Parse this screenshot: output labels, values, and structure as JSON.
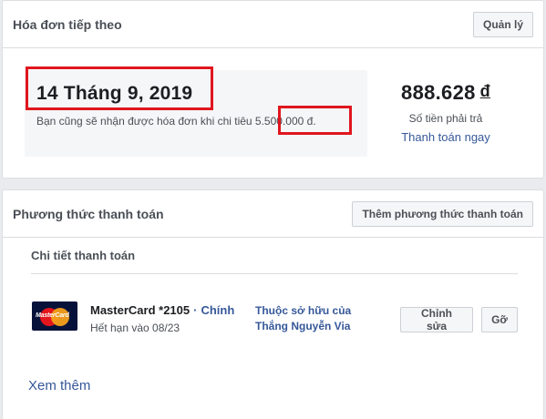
{
  "next_bill": {
    "title": "Hóa đơn tiếp theo",
    "manage_label": "Quản lý",
    "date": "14 Tháng 9, 2019",
    "description": "Bạn cũng sẽ nhận được hóa đơn khi chi tiêu 5.500.000 đ.",
    "amount": "888.628",
    "currency": "đ",
    "amount_label": "Số tiền phải trả",
    "pay_now_label": "Thanh toán ngay"
  },
  "payment_methods": {
    "title": "Phương thức thanh toán",
    "add_label": "Thêm phương thức thanh toán",
    "details_title": "Chi tiết thanh toán",
    "card": {
      "logo_text": "MasterCard",
      "name": "MasterCard *2105",
      "separator": "·",
      "primary_label": "Chính",
      "expiry": "Hết hạn vào 08/23",
      "owner_line1": "Thuộc sở hữu của",
      "owner_line2": "Thắng Nguyễn Via",
      "edit_label": "Chỉnh sửa",
      "remove_label": "Gỡ"
    },
    "see_more_label": "Xem thêm"
  },
  "colors": {
    "link": "#365899",
    "highlight": "#e0161e",
    "background": "#e9ebee"
  }
}
